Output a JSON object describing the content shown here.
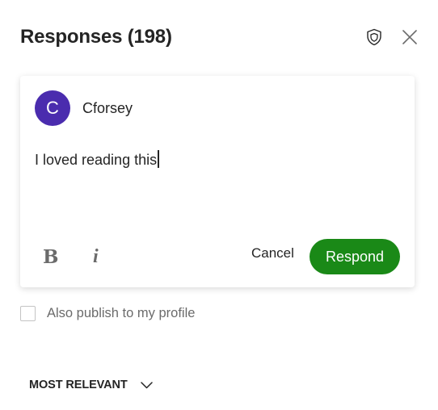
{
  "header": {
    "title": "Responses (198)",
    "icons": [
      "shield-icon",
      "close-icon"
    ]
  },
  "composer": {
    "avatar_letter": "C",
    "avatar_color": "#4a2cae",
    "username": "Cforsey",
    "text_value": "I loved reading this",
    "bold_glyph": "B",
    "italic_glyph": "i",
    "cancel_label": "Cancel",
    "respond_label": "Respond",
    "respond_color": "#1a8917"
  },
  "publish": {
    "label": "Also publish to my profile",
    "checked": false
  },
  "sort": {
    "label": "MOST RELEVANT",
    "icon": "chevron-down-icon"
  }
}
